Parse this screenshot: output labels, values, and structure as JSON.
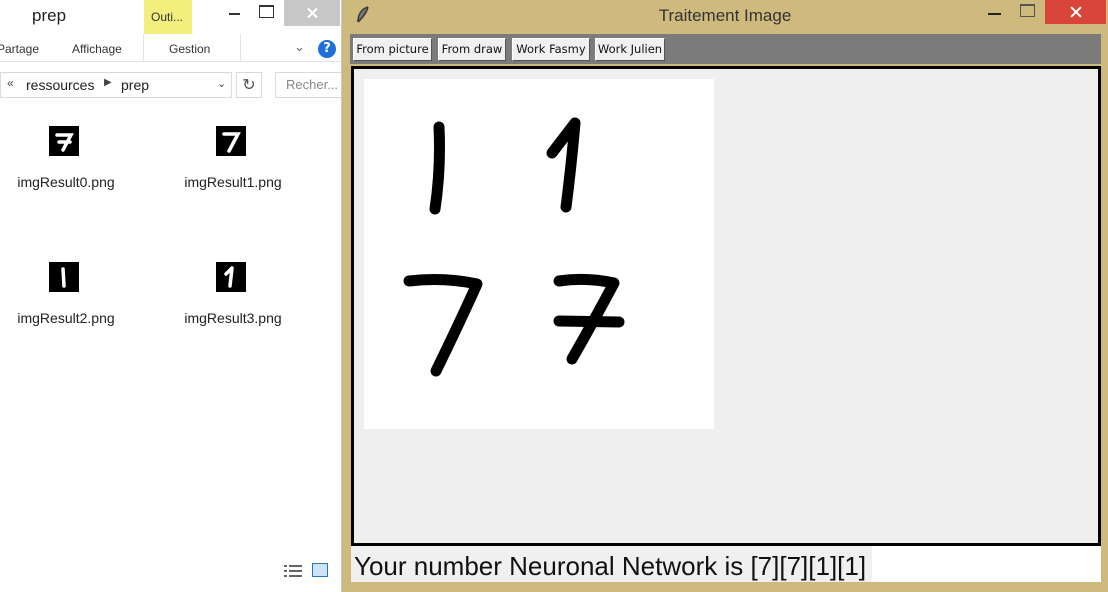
{
  "explorer": {
    "title": "prep",
    "context_tab": "Outi...",
    "ribbon_tabs": [
      "Partage",
      "Affichage",
      "Gestion"
    ],
    "help": "?",
    "address": {
      "back": "«",
      "segments": [
        "ressources",
        "prep"
      ]
    },
    "search_placeholder": "Recher...",
    "files": [
      {
        "name": "imgResult0.png",
        "digit": "7"
      },
      {
        "name": "imgResult1.png",
        "digit": "7"
      },
      {
        "name": "imgResult2.png",
        "digit": "1"
      },
      {
        "name": "imgResult3.png",
        "digit": "1"
      }
    ]
  },
  "app": {
    "title": "Traitement Image",
    "buttons": {
      "from_picture": "From picture",
      "from_draw": "From draw",
      "work_fasmy": "Work Fasmy",
      "work_julien": "Work Julien"
    },
    "result_text": "Your number Neuronal Network is [7][7][1][1]",
    "drawing_digits": [
      "1",
      "1",
      "7",
      "7"
    ]
  },
  "colors": {
    "titlebar_active": "#cfba7d",
    "close_button": "#d9453b",
    "toolbar": "#7b7b7b",
    "canvas_bg": "#efefef",
    "context_tab": "#f3ef7f"
  }
}
